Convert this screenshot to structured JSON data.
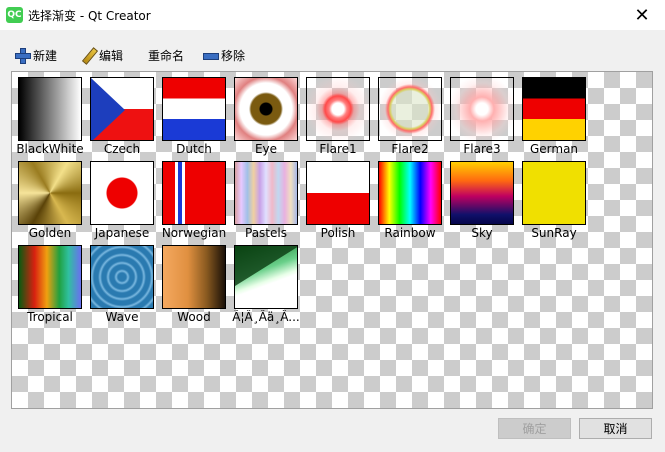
{
  "window": {
    "title": "选择渐变 - Qt Creator",
    "app_icon_text": "QC",
    "close_glyph": "✕"
  },
  "toolbar": {
    "new_label": "新建",
    "edit_label": "编辑",
    "rename_label": "重命名",
    "remove_label": "移除"
  },
  "gradients": [
    {
      "label": "BlackWhite"
    },
    {
      "label": "Czech"
    },
    {
      "label": "Dutch"
    },
    {
      "label": "Eye"
    },
    {
      "label": "Flare1"
    },
    {
      "label": "Flare2"
    },
    {
      "label": "Flare3"
    },
    {
      "label": "German"
    },
    {
      "label": "Golden"
    },
    {
      "label": "Japanese"
    },
    {
      "label": "Norwegian"
    },
    {
      "label": "Pastels"
    },
    {
      "label": "Polish"
    },
    {
      "label": "Rainbow"
    },
    {
      "label": "Sky"
    },
    {
      "label": "SunRay"
    },
    {
      "label": "Tropical"
    },
    {
      "label": "Wave"
    },
    {
      "label": "Wood"
    },
    {
      "label": "Ã¦Â¸Â­ä¸Â..."
    }
  ],
  "buttons": {
    "ok_label": "确定",
    "cancel_label": "取消",
    "ok_enabled": false
  }
}
